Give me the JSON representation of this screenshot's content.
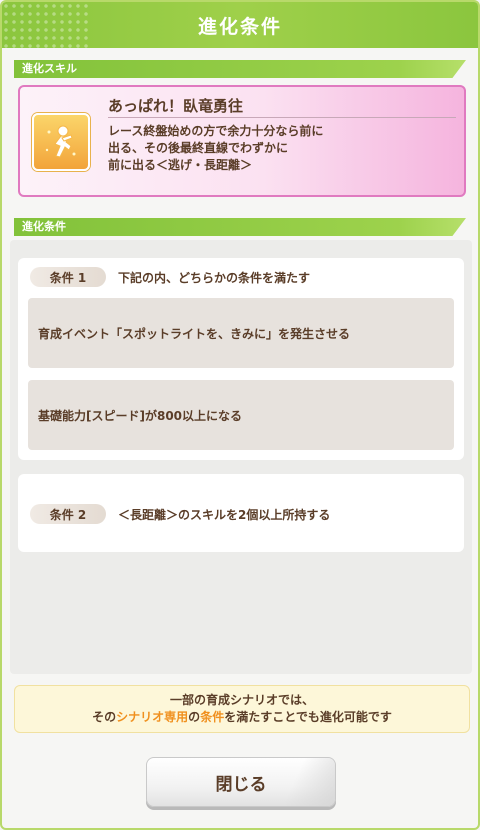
{
  "dialog": {
    "title": "進化条件",
    "close_label": "閉じる"
  },
  "skill_section": {
    "header": "進化スキル",
    "skill": {
      "name": "あっぱれ！臥竜勇往",
      "desc_line1": "レース終盤始めの方で余力十分なら前に",
      "desc_line2": "出る、その後最終直線でわずかに",
      "desc_line3": "前に出る＜逃げ・長距離＞",
      "icon": "running-figure-icon"
    }
  },
  "conditions_section": {
    "header": "進化条件",
    "conditions": [
      {
        "label": "条件 1",
        "title": "下記の内、どちらかの条件を満たす",
        "sub": [
          "育成イベント「スポットライトを、きみに」を発生させる",
          "基礎能力[スピード]が800以上になる"
        ]
      },
      {
        "label": "条件 2",
        "title": "＜長距離＞のスキルを2個以上所持する"
      }
    ]
  },
  "notice": {
    "line1": "一部の育成シナリオでは、",
    "line2_pre": "その",
    "line2_hl1": "シナリオ専用",
    "line2_mid": "の",
    "line2_hl2": "条件",
    "line2_post": "を満たすことでも進化可能です"
  },
  "colors": {
    "accent_green": "#8bc63e",
    "skill_pink_border": "#e07ac0",
    "highlight_orange": "#f0901e",
    "text_brown": "#5a3d28"
  }
}
